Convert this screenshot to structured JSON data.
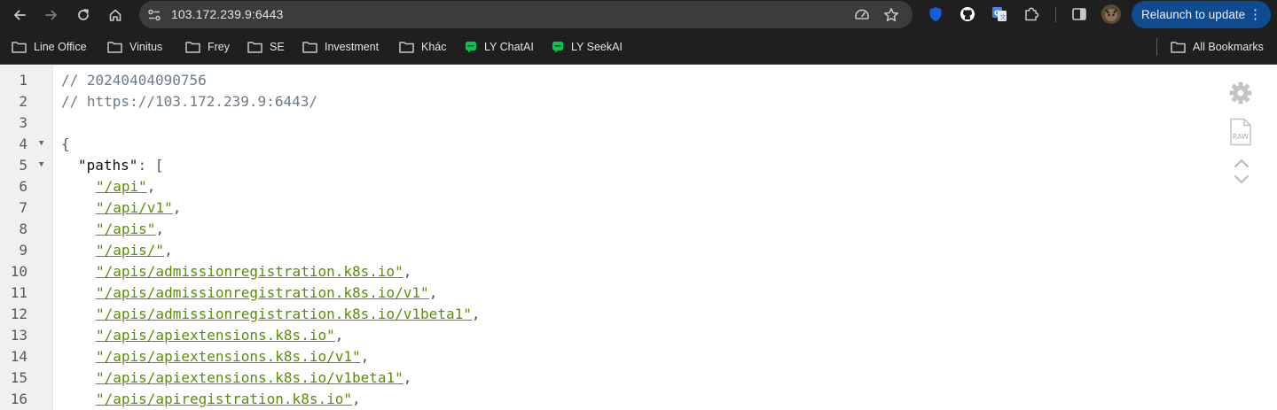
{
  "browser": {
    "url": "103.172.239.9:6443",
    "relaunch_label": "Relaunch to update",
    "icons": {
      "back": "arrow-left-icon",
      "forward": "arrow-right-icon",
      "reload": "reload-icon",
      "home": "home-icon",
      "site_info": "tune-icon",
      "performance": "speedometer-icon",
      "bookmark_star": "star-icon",
      "side_panel": "side-panel-icon",
      "menu": "kebab-menu-icon"
    },
    "accent_color": "#0f4b8f"
  },
  "bookmarks": {
    "items": [
      {
        "label": "Line Office",
        "icon": "folder-icon"
      },
      {
        "label": "Vinitus",
        "icon": "folder-icon"
      },
      {
        "label": "Frey",
        "icon": "folder-icon"
      },
      {
        "label": "SE",
        "icon": "folder-icon"
      },
      {
        "label": "Investment",
        "icon": "folder-icon"
      },
      {
        "label": "Khác",
        "icon": "folder-icon"
      },
      {
        "label": "LY ChatAI",
        "icon": "chat-icon"
      },
      {
        "label": "LY SeekAI",
        "icon": "chat-icon"
      }
    ],
    "all_bookmarks_label": "All Bookmarks"
  },
  "viewer": {
    "lines": [
      {
        "num": "1",
        "text": "// 20240404090756"
      },
      {
        "num": "2",
        "text": "// https://103.172.239.9:6443/"
      },
      {
        "num": "3",
        "text": ""
      },
      {
        "num": "4",
        "text": "{"
      },
      {
        "num": "5",
        "key": "\"paths\"",
        "sep": ": ",
        "open": "["
      },
      {
        "num": "6",
        "link": "\"/api\"",
        "comma": ","
      },
      {
        "num": "7",
        "link": "\"/api/v1\"",
        "comma": ","
      },
      {
        "num": "8",
        "link": "\"/apis\"",
        "comma": ","
      },
      {
        "num": "9",
        "link": "\"/apis/\"",
        "comma": ","
      },
      {
        "num": "10",
        "link": "\"/apis/admissionregistration.k8s.io\"",
        "comma": ","
      },
      {
        "num": "11",
        "link": "\"/apis/admissionregistration.k8s.io/v1\"",
        "comma": ","
      },
      {
        "num": "12",
        "link": "\"/apis/admissionregistration.k8s.io/v1beta1\"",
        "comma": ","
      },
      {
        "num": "13",
        "link": "\"/apis/apiextensions.k8s.io\"",
        "comma": ","
      },
      {
        "num": "14",
        "link": "\"/apis/apiextensions.k8s.io/v1\"",
        "comma": ","
      },
      {
        "num": "15",
        "link": "\"/apis/apiextensions.k8s.io/v1beta1\"",
        "comma": ","
      },
      {
        "num": "16",
        "link": "\"/apis/apiregistration.k8s.io\"",
        "comma": ","
      }
    ],
    "side_icons": {
      "settings": "gear-icon",
      "raw": "raw-file-icon",
      "raw_label": "RAW",
      "up": "chevron-up-icon",
      "down": "chevron-down-icon"
    }
  }
}
